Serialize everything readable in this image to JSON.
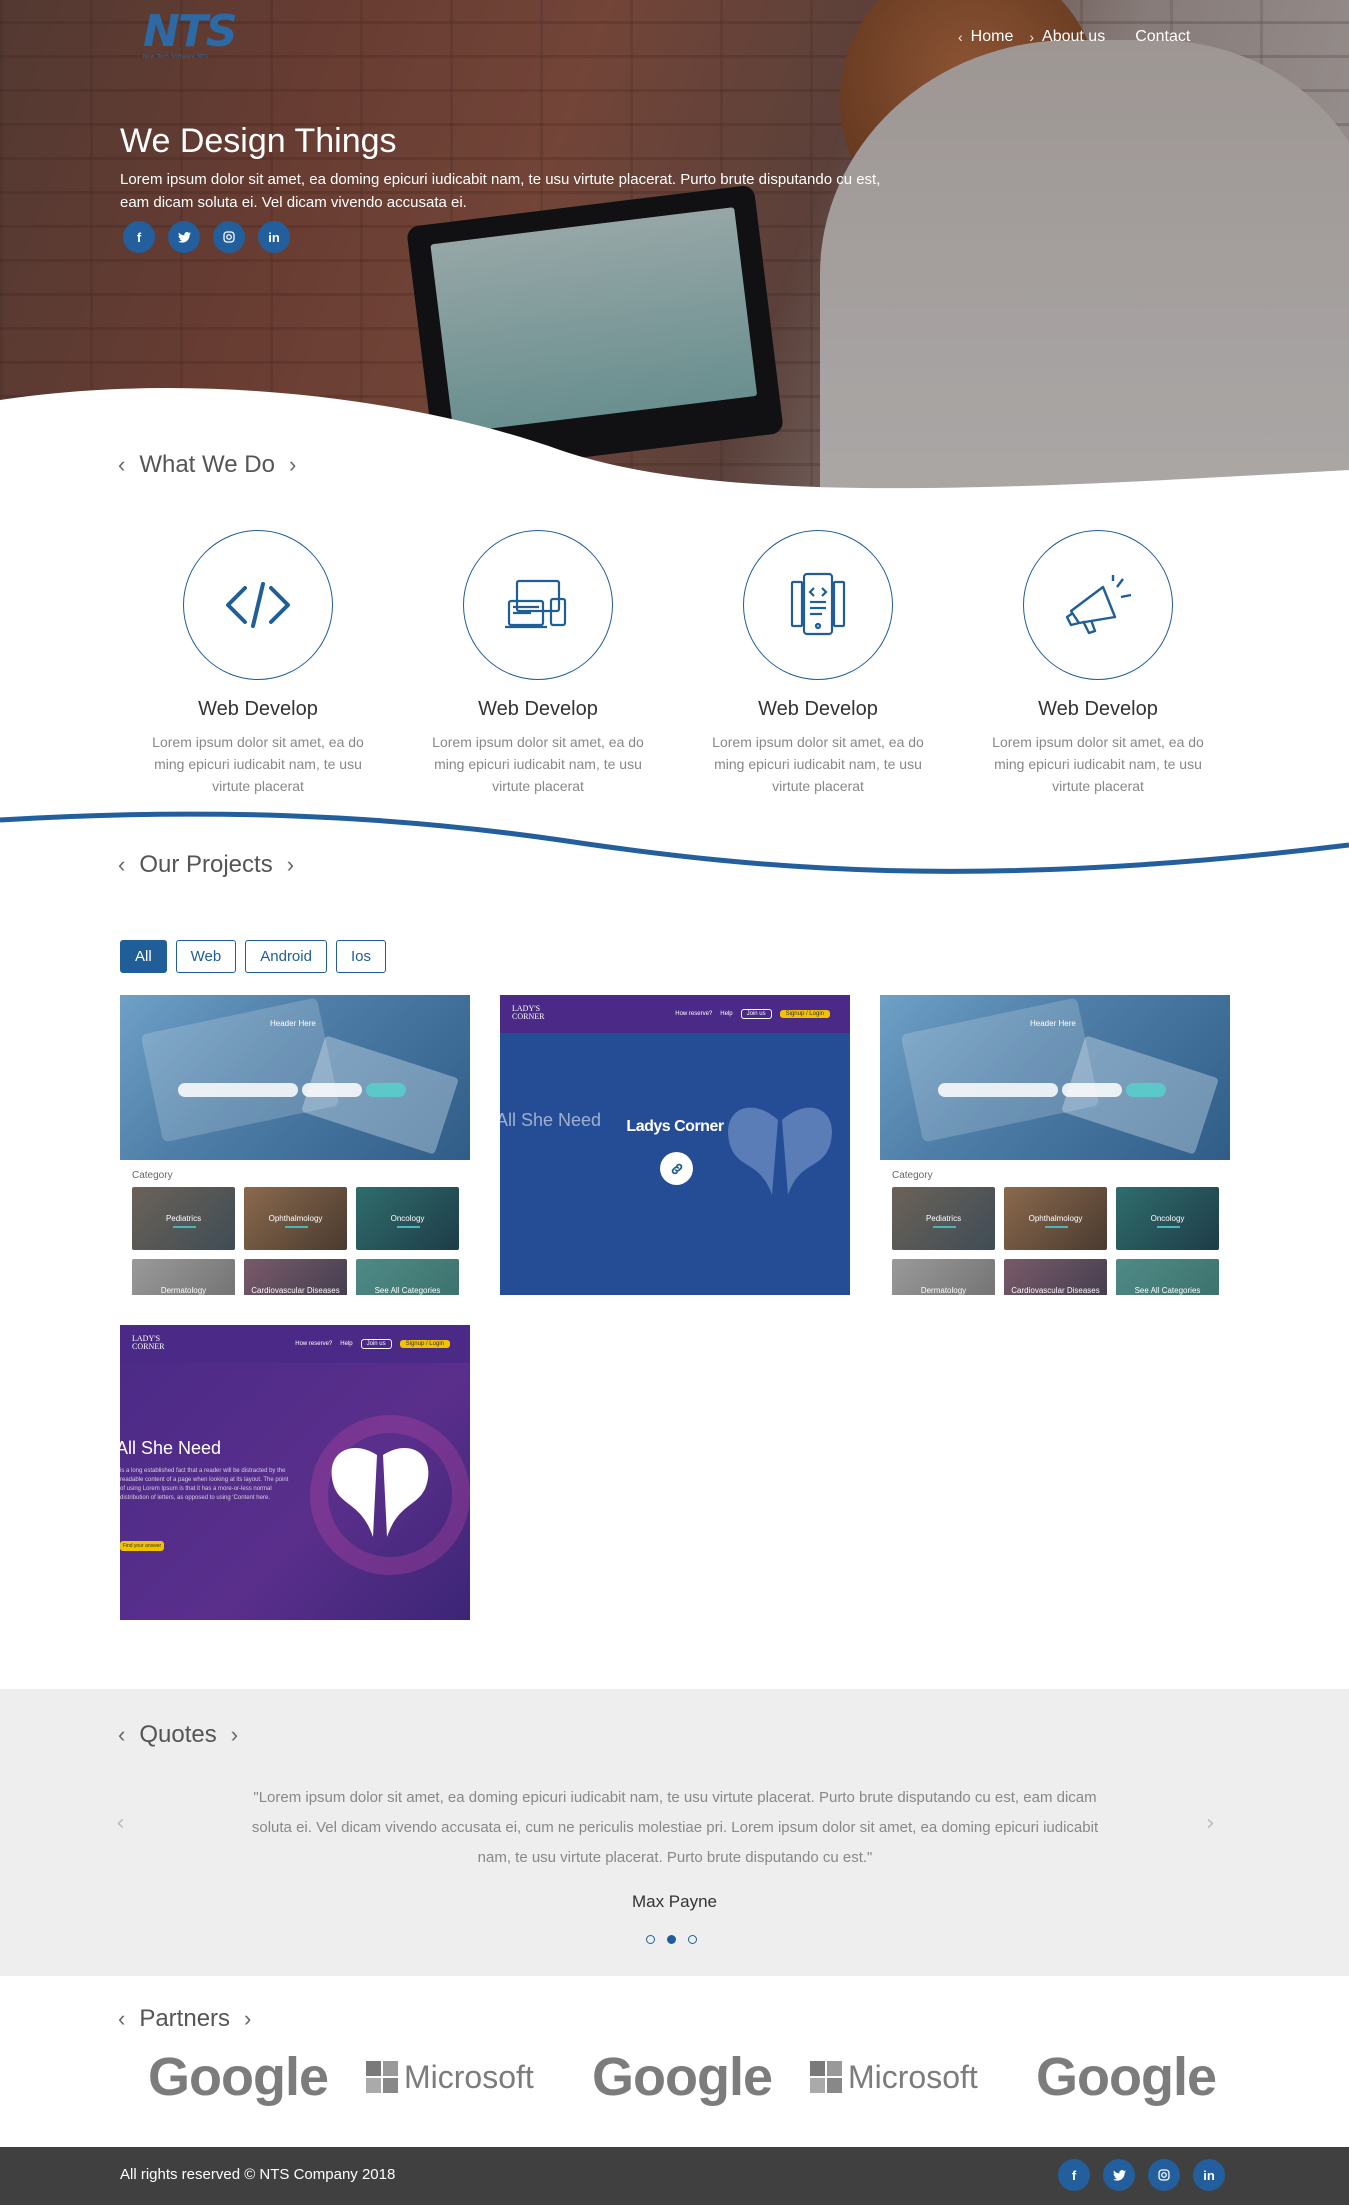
{
  "brand": {
    "logo_text": "NTS",
    "logo_tag": "New Tech Software NTS"
  },
  "nav": [
    {
      "label": "Home"
    },
    {
      "label": "About us"
    },
    {
      "label": "Contact"
    }
  ],
  "hero": {
    "title": "We Design Things",
    "text": "Lorem ipsum dolor sit amet, ea doming epicuri iudicabit nam, te usu virtute placerat. Purto brute disputando cu est, eam dicam soluta ei. Vel dicam vivendo accusata ei."
  },
  "social_icons": [
    {
      "icon": "facebook-icon",
      "glyph": "f"
    },
    {
      "icon": "twitter-icon",
      "glyph": "t"
    },
    {
      "icon": "instagram-icon",
      "glyph": "◎"
    },
    {
      "icon": "linkedin-icon",
      "glyph": "in"
    }
  ],
  "what_we_do": {
    "title": "What We Do",
    "services": [
      {
        "icon": "code-icon",
        "title": "Web Develop",
        "text": "Lorem ipsum dolor sit amet, ea do ming epicuri iudicabit nam, te usu virtute placerat"
      },
      {
        "icon": "devices-icon",
        "title": "Web Develop",
        "text": "Lorem ipsum dolor sit amet, ea do ming epicuri iudicabit nam, te usu virtute placerat"
      },
      {
        "icon": "mobile-code-icon",
        "title": "Web Develop",
        "text": "Lorem ipsum dolor sit amet, ea do ming epicuri iudicabit nam, te usu virtute placerat"
      },
      {
        "icon": "megaphone-icon",
        "title": "Web Develop",
        "text": "Lorem ipsum dolor sit amet, ea do ming epicuri iudicabit nam, te usu virtute placerat"
      }
    ]
  },
  "projects": {
    "title": "Our Projects",
    "filters": [
      {
        "label": "All",
        "active": true
      },
      {
        "label": "Web",
        "active": false
      },
      {
        "label": "Android",
        "active": false
      },
      {
        "label": "Ios",
        "active": false
      }
    ],
    "medical": {
      "header": "Header Here",
      "category_label": "Category",
      "tiles": [
        "Pediatrics",
        "Ophthalmology",
        "Oncology",
        "Dermatology",
        "Cardiovascular Diseases",
        "See All Categories"
      ]
    },
    "ladys": {
      "brand_line1": "LADY'S",
      "brand_line2": "CORNER",
      "menu": [
        "How reserve?",
        "Help",
        "Join us",
        "Signup / Login"
      ],
      "headline": "All She Need",
      "overlay_title": "Ladys Corner",
      "body": "is a long established fact that a reader will be distracted by the readable content of a page when looking at its layout. The point of using Lorem Ipsum is that it has a more-or-less normal distribution of letters, as opposed to using 'Content here.",
      "cta": "Find your answer"
    }
  },
  "quotes": {
    "title": "Quotes",
    "text": "\"Lorem ipsum dolor sit amet, ea doming epicuri iudicabit nam, te usu virtute placerat. Purto brute disputando cu est, eam dicam soluta ei. Vel dicam vivendo accusata ei, cum ne periculis molestiae pri. Lorem ipsum dolor sit amet, ea doming epicuri iudicabit nam, te usu virtute placerat. Purto brute disputando cu est.\"",
    "author": "Max Payne",
    "active_index": 1
  },
  "partners": {
    "title": "Partners",
    "logos": [
      "Google",
      "Microsoft",
      "Google",
      "Microsoft",
      "Google"
    ]
  },
  "footer": {
    "copyright": "All rights reserved © NTS Company 2018"
  },
  "colors": {
    "accent": "#1f5e97",
    "footer": "#404040",
    "quotes_bg": "#eeeeee"
  }
}
